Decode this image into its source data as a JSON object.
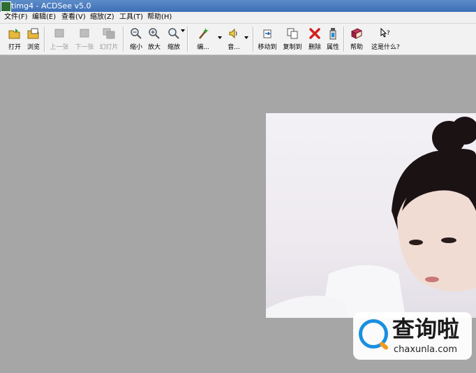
{
  "window": {
    "title": "timg4 - ACDSee v5.0"
  },
  "menu": [
    "文件(F)",
    "编辑(E)",
    "查看(V)",
    "缩放(Z)",
    "工具(T)",
    "帮助(H)"
  ],
  "toolbar": {
    "open": "打开",
    "browse": "浏览",
    "prev": "上一张",
    "next": "下一张",
    "slideshow": "幻灯片",
    "zoom_out": "缩小",
    "zoom_in": "放大",
    "zoom": "缩放",
    "edit": "编...",
    "audio": "音...",
    "move_to": "移动到",
    "copy_to": "复制到",
    "delete": "删除",
    "properties": "属性",
    "help": "帮助",
    "whats_this": "这是什么?"
  },
  "watermark": {
    "chinese": "查询啦",
    "domain": "chaxunla.com"
  },
  "colors": {
    "titlebar": "#4a7cc0",
    "viewer_bg": "#a6a6a6",
    "delete_red": "#d22020"
  }
}
